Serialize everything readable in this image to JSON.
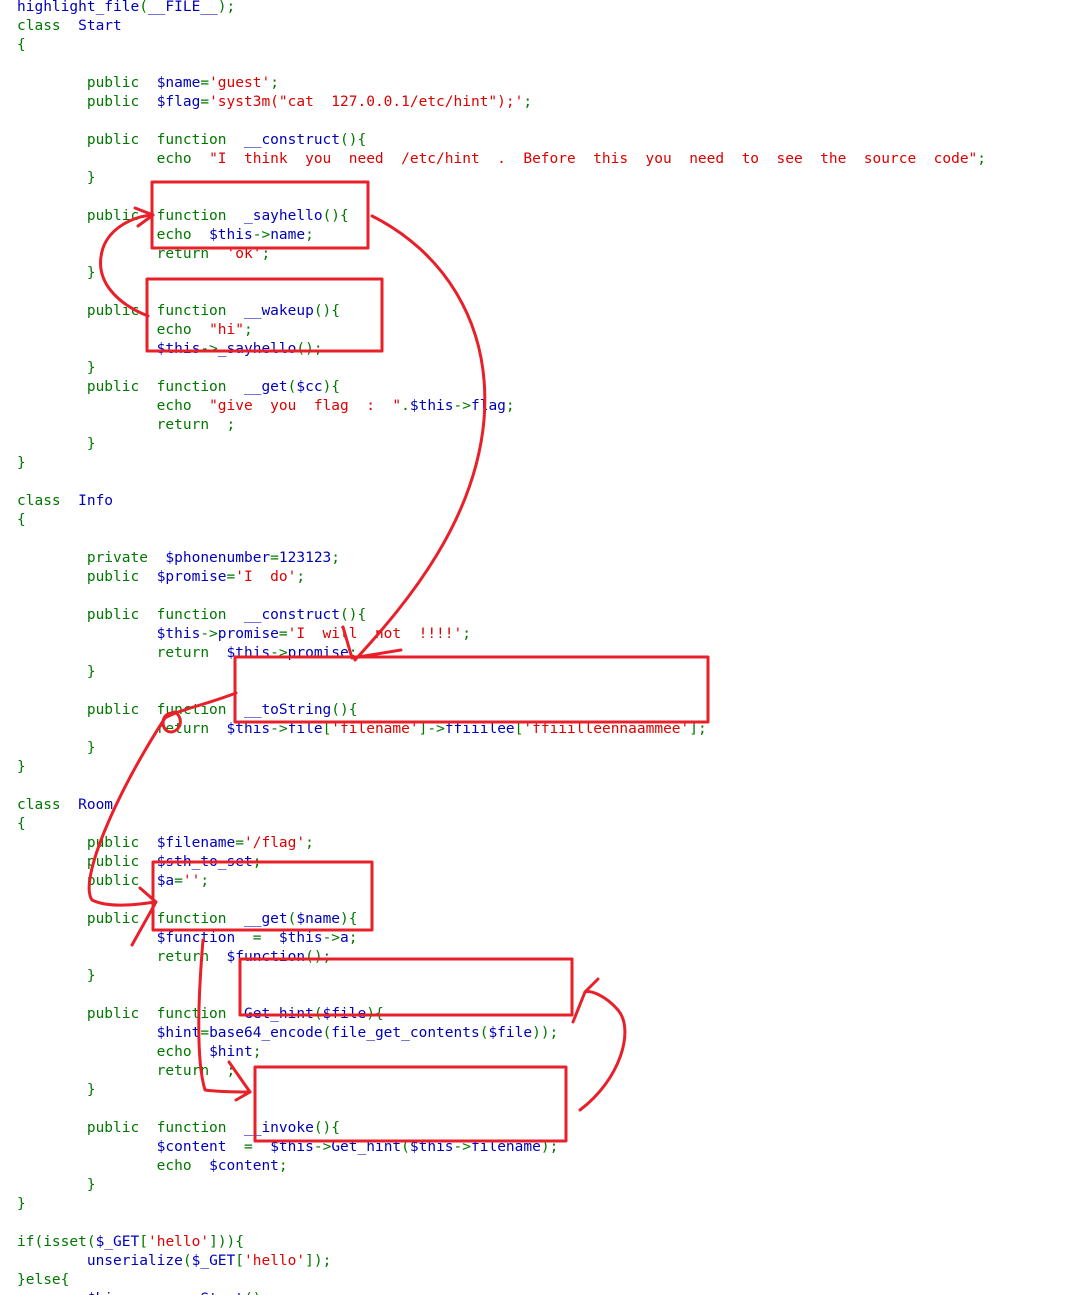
{
  "code_lines": [
    [
      [
        "nm",
        "highlight_file"
      ],
      [
        "pn",
        "("
      ],
      [
        "nm",
        "__FILE__"
      ],
      [
        "pn",
        ");"
      ]
    ],
    [
      [
        "kw",
        "class  "
      ],
      [
        "nm",
        "Start"
      ]
    ],
    [
      [
        "pn",
        "{"
      ]
    ],
    [],
    [
      [
        "kw",
        "        public  "
      ],
      [
        "nm",
        "$name"
      ],
      [
        "pn",
        "="
      ],
      [
        "st",
        "'guest'"
      ],
      [
        "pn",
        ";"
      ]
    ],
    [
      [
        "kw",
        "        public  "
      ],
      [
        "nm",
        "$flag"
      ],
      [
        "pn",
        "="
      ],
      [
        "st",
        "'syst3m(\"cat  127.0.0.1/etc/hint\");'"
      ],
      [
        "pn",
        ";"
      ]
    ],
    [],
    [
      [
        "kw",
        "        public  function  "
      ],
      [
        "nm",
        "__construct"
      ],
      [
        "pn",
        "(){"
      ]
    ],
    [
      [
        "kw",
        "                echo  "
      ],
      [
        "st",
        "\"I  think  you  need  /etc/hint  .  Before  this  you  need  to  see  the  source  code\""
      ],
      [
        "pn",
        ";"
      ]
    ],
    [
      [
        "pn",
        "        }"
      ]
    ],
    [],
    [
      [
        "kw",
        "        public  function  "
      ],
      [
        "nm",
        "_sayhello"
      ],
      [
        "pn",
        "(){"
      ]
    ],
    [
      [
        "kw",
        "                echo  "
      ],
      [
        "nm",
        "$this"
      ],
      [
        "pn",
        "->"
      ],
      [
        "nm",
        "name"
      ],
      [
        "pn",
        ";"
      ]
    ],
    [
      [
        "kw",
        "                return  "
      ],
      [
        "st",
        "'ok'"
      ],
      [
        "pn",
        ";"
      ]
    ],
    [
      [
        "pn",
        "        }"
      ]
    ],
    [],
    [
      [
        "kw",
        "        public  function  "
      ],
      [
        "nm",
        "__wakeup"
      ],
      [
        "pn",
        "(){"
      ]
    ],
    [
      [
        "kw",
        "                echo  "
      ],
      [
        "st",
        "\"hi\""
      ],
      [
        "pn",
        ";"
      ]
    ],
    [
      [
        "nm",
        "                $this"
      ],
      [
        "pn",
        "->"
      ],
      [
        "nm",
        "_sayhello"
      ],
      [
        "pn",
        "();"
      ]
    ],
    [
      [
        "pn",
        "        }"
      ]
    ],
    [
      [
        "kw",
        "        public  function  "
      ],
      [
        "nm",
        "__get"
      ],
      [
        "pn",
        "("
      ],
      [
        "nm",
        "$cc"
      ],
      [
        "pn",
        "){"
      ]
    ],
    [
      [
        "kw",
        "                echo  "
      ],
      [
        "st",
        "\"give  you  flag  :  \""
      ],
      [
        "pn",
        "."
      ],
      [
        "nm",
        "$this"
      ],
      [
        "pn",
        "->"
      ],
      [
        "nm",
        "flag"
      ],
      [
        "pn",
        ";"
      ]
    ],
    [
      [
        "kw",
        "                return  "
      ],
      [
        "pn",
        ";"
      ]
    ],
    [
      [
        "pn",
        "        }"
      ]
    ],
    [
      [
        "pn",
        "}"
      ]
    ],
    [],
    [
      [
        "kw",
        "class  "
      ],
      [
        "nm",
        "Info"
      ]
    ],
    [
      [
        "pn",
        "{"
      ]
    ],
    [],
    [
      [
        "kw",
        "        private  "
      ],
      [
        "nm",
        "$phonenumber"
      ],
      [
        "pn",
        "="
      ],
      [
        "nm",
        "123123"
      ],
      [
        "pn",
        ";"
      ]
    ],
    [
      [
        "kw",
        "        public  "
      ],
      [
        "nm",
        "$promise"
      ],
      [
        "pn",
        "="
      ],
      [
        "st",
        "'I  do'"
      ],
      [
        "pn",
        ";"
      ]
    ],
    [],
    [
      [
        "kw",
        "        public  function  "
      ],
      [
        "nm",
        "__construct"
      ],
      [
        "pn",
        "(){"
      ]
    ],
    [
      [
        "nm",
        "                $this"
      ],
      [
        "pn",
        "->"
      ],
      [
        "nm",
        "promise"
      ],
      [
        "pn",
        "="
      ],
      [
        "st",
        "'I  will  not  !!!!'"
      ],
      [
        "pn",
        ";"
      ]
    ],
    [
      [
        "kw",
        "                return  "
      ],
      [
        "nm",
        "$this"
      ],
      [
        "pn",
        "->"
      ],
      [
        "nm",
        "promise"
      ],
      [
        "pn",
        ";"
      ]
    ],
    [
      [
        "pn",
        "        }"
      ]
    ],
    [],
    [
      [
        "kw",
        "        public  function  "
      ],
      [
        "nm",
        "__toString"
      ],
      [
        "pn",
        "(){"
      ]
    ],
    [
      [
        "kw",
        "                return  "
      ],
      [
        "nm",
        "$this"
      ],
      [
        "pn",
        "->"
      ],
      [
        "nm",
        "file"
      ],
      [
        "pn",
        "["
      ],
      [
        "st",
        "'filename'"
      ],
      [
        "pn",
        "]->"
      ],
      [
        "nm",
        "ffiiilee"
      ],
      [
        "pn",
        "["
      ],
      [
        "st",
        "'ffiiilleennaammee'"
      ],
      [
        "pn",
        "];"
      ]
    ],
    [
      [
        "pn",
        "        }"
      ]
    ],
    [
      [
        "pn",
        "}"
      ]
    ],
    [],
    [
      [
        "kw",
        "class  "
      ],
      [
        "nm",
        "Room"
      ]
    ],
    [
      [
        "pn",
        "{"
      ]
    ],
    [
      [
        "kw",
        "        public  "
      ],
      [
        "nm",
        "$filename"
      ],
      [
        "pn",
        "="
      ],
      [
        "st",
        "'/flag'"
      ],
      [
        "pn",
        ";"
      ]
    ],
    [
      [
        "kw",
        "        public  "
      ],
      [
        "nm",
        "$sth_to_set"
      ],
      [
        "pn",
        ";"
      ]
    ],
    [
      [
        "kw",
        "        public  "
      ],
      [
        "nm",
        "$a"
      ],
      [
        "pn",
        "="
      ],
      [
        "st",
        "''"
      ],
      [
        "pn",
        ";"
      ]
    ],
    [],
    [
      [
        "kw",
        "        public  function  "
      ],
      [
        "nm",
        "__get"
      ],
      [
        "pn",
        "("
      ],
      [
        "nm",
        "$name"
      ],
      [
        "pn",
        "){"
      ]
    ],
    [
      [
        "nm",
        "                $function  "
      ],
      [
        "pn",
        "=  "
      ],
      [
        "nm",
        "$this"
      ],
      [
        "pn",
        "->"
      ],
      [
        "nm",
        "a"
      ],
      [
        "pn",
        ";"
      ]
    ],
    [
      [
        "kw",
        "                return  "
      ],
      [
        "nm",
        "$function"
      ],
      [
        "pn",
        "();"
      ]
    ],
    [
      [
        "pn",
        "        }"
      ]
    ],
    [],
    [
      [
        "kw",
        "        public  function  "
      ],
      [
        "nm",
        "Get_hint"
      ],
      [
        "pn",
        "("
      ],
      [
        "nm",
        "$file"
      ],
      [
        "pn",
        "){"
      ]
    ],
    [
      [
        "nm",
        "                $hint"
      ],
      [
        "pn",
        "="
      ],
      [
        "nm",
        "base64_encode"
      ],
      [
        "pn",
        "("
      ],
      [
        "nm",
        "file_get_contents"
      ],
      [
        "pn",
        "("
      ],
      [
        "nm",
        "$file"
      ],
      [
        "pn",
        "));"
      ]
    ],
    [
      [
        "kw",
        "                echo  "
      ],
      [
        "nm",
        "$hint"
      ],
      [
        "pn",
        ";"
      ]
    ],
    [
      [
        "kw",
        "                return  "
      ],
      [
        "pn",
        ";"
      ]
    ],
    [
      [
        "pn",
        "        }"
      ]
    ],
    [],
    [
      [
        "kw",
        "        public  function  "
      ],
      [
        "nm",
        "__invoke"
      ],
      [
        "pn",
        "(){"
      ]
    ],
    [
      [
        "nm",
        "                $content  "
      ],
      [
        "pn",
        "=  "
      ],
      [
        "nm",
        "$this"
      ],
      [
        "pn",
        "->"
      ],
      [
        "nm",
        "Get_hint"
      ],
      [
        "pn",
        "("
      ],
      [
        "nm",
        "$this"
      ],
      [
        "pn",
        "->"
      ],
      [
        "nm",
        "filename"
      ],
      [
        "pn",
        ");"
      ]
    ],
    [
      [
        "kw",
        "                echo  "
      ],
      [
        "nm",
        "$content"
      ],
      [
        "pn",
        ";"
      ]
    ],
    [
      [
        "pn",
        "        }"
      ]
    ],
    [
      [
        "pn",
        "}"
      ]
    ],
    [],
    [
      [
        "kw",
        "if"
      ],
      [
        "pn",
        "("
      ],
      [
        "kw",
        "isset"
      ],
      [
        "pn",
        "("
      ],
      [
        "nm",
        "$_GET"
      ],
      [
        "pn",
        "["
      ],
      [
        "st",
        "'hello'"
      ],
      [
        "pn",
        "])){"
      ]
    ],
    [
      [
        "nm",
        "        unserialize"
      ],
      [
        "pn",
        "("
      ],
      [
        "nm",
        "$_GET"
      ],
      [
        "pn",
        "["
      ],
      [
        "st",
        "'hello'"
      ],
      [
        "pn",
        "]);"
      ]
    ],
    [
      [
        "pn",
        "}"
      ],
      [
        "kw",
        "else"
      ],
      [
        "pn",
        "{"
      ]
    ],
    [
      [
        "nm",
        "        $hi  "
      ],
      [
        "pn",
        "=  "
      ],
      [
        "kw",
        "new  "
      ],
      [
        "nm",
        "Start"
      ],
      [
        "pn",
        "();"
      ]
    ],
    [
      [
        "pn",
        "}"
      ]
    ]
  ],
  "colors": {
    "keyword": "#007700",
    "identifier": "#0000BB",
    "string": "#DD0000",
    "annotation": "#E8202A",
    "background": "#FFFFFF"
  }
}
